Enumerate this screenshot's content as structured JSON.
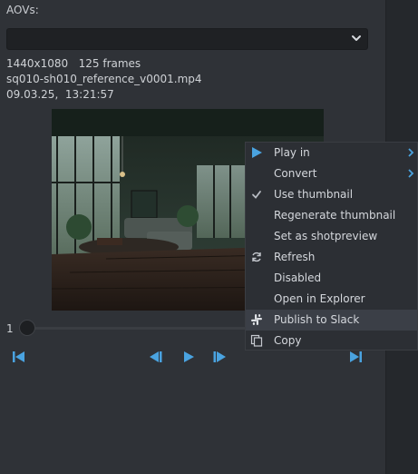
{
  "aovs": {
    "label": "AOVs:",
    "selected": ""
  },
  "media": {
    "resolution_frames": "1440x1080   125 frames",
    "filename": "sq010-sh010_reference_v0001.mp4",
    "datetime": "09.03.25,  13:21:57"
  },
  "timeline": {
    "current_frame": "1"
  },
  "context_menu": {
    "items": [
      {
        "label": "Play in",
        "icon": "play-icon",
        "submenu": true
      },
      {
        "label": "Convert",
        "icon": "",
        "submenu": true
      },
      {
        "label": "Use thumbnail",
        "icon": "checkmark-icon",
        "checked": true
      },
      {
        "label": "Regenerate thumbnail",
        "icon": ""
      },
      {
        "label": "Set as shotpreview",
        "icon": ""
      },
      {
        "label": "Refresh",
        "icon": "refresh-icon"
      },
      {
        "label": "Disabled",
        "icon": ""
      },
      {
        "label": "Open in Explorer",
        "icon": ""
      },
      {
        "label": "Publish to Slack",
        "icon": "slack-icon",
        "highlighted": true
      },
      {
        "label": "Copy",
        "icon": "copy-icon"
      }
    ]
  },
  "colors": {
    "accent": "#4aa3e0",
    "background": "#2f3237",
    "menu_highlight": "#3b3f47"
  }
}
